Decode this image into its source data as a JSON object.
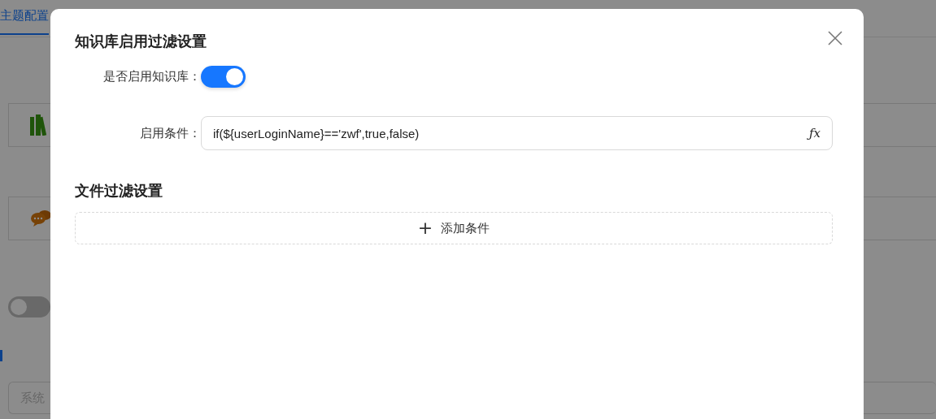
{
  "background": {
    "tabs": [
      {
        "label": "主题配置",
        "selected": true
      }
    ],
    "icon_cards": [
      {
        "kind": "books"
      },
      {
        "kind": "chat"
      }
    ],
    "toggle": {
      "on": false
    },
    "input": {
      "placeholder": "系统"
    }
  },
  "dialog": {
    "title": "知识库启用过滤设置",
    "enable_field": {
      "label": "是否启用知识库：",
      "on": true
    },
    "condition_field": {
      "label": "启用条件：",
      "value": "if(${userLoginName}=='zwf',true,false)",
      "button": "ƒx"
    },
    "section_title": "文件过滤设置",
    "add_button": {
      "icon": "+",
      "label": "添加条件"
    }
  }
}
